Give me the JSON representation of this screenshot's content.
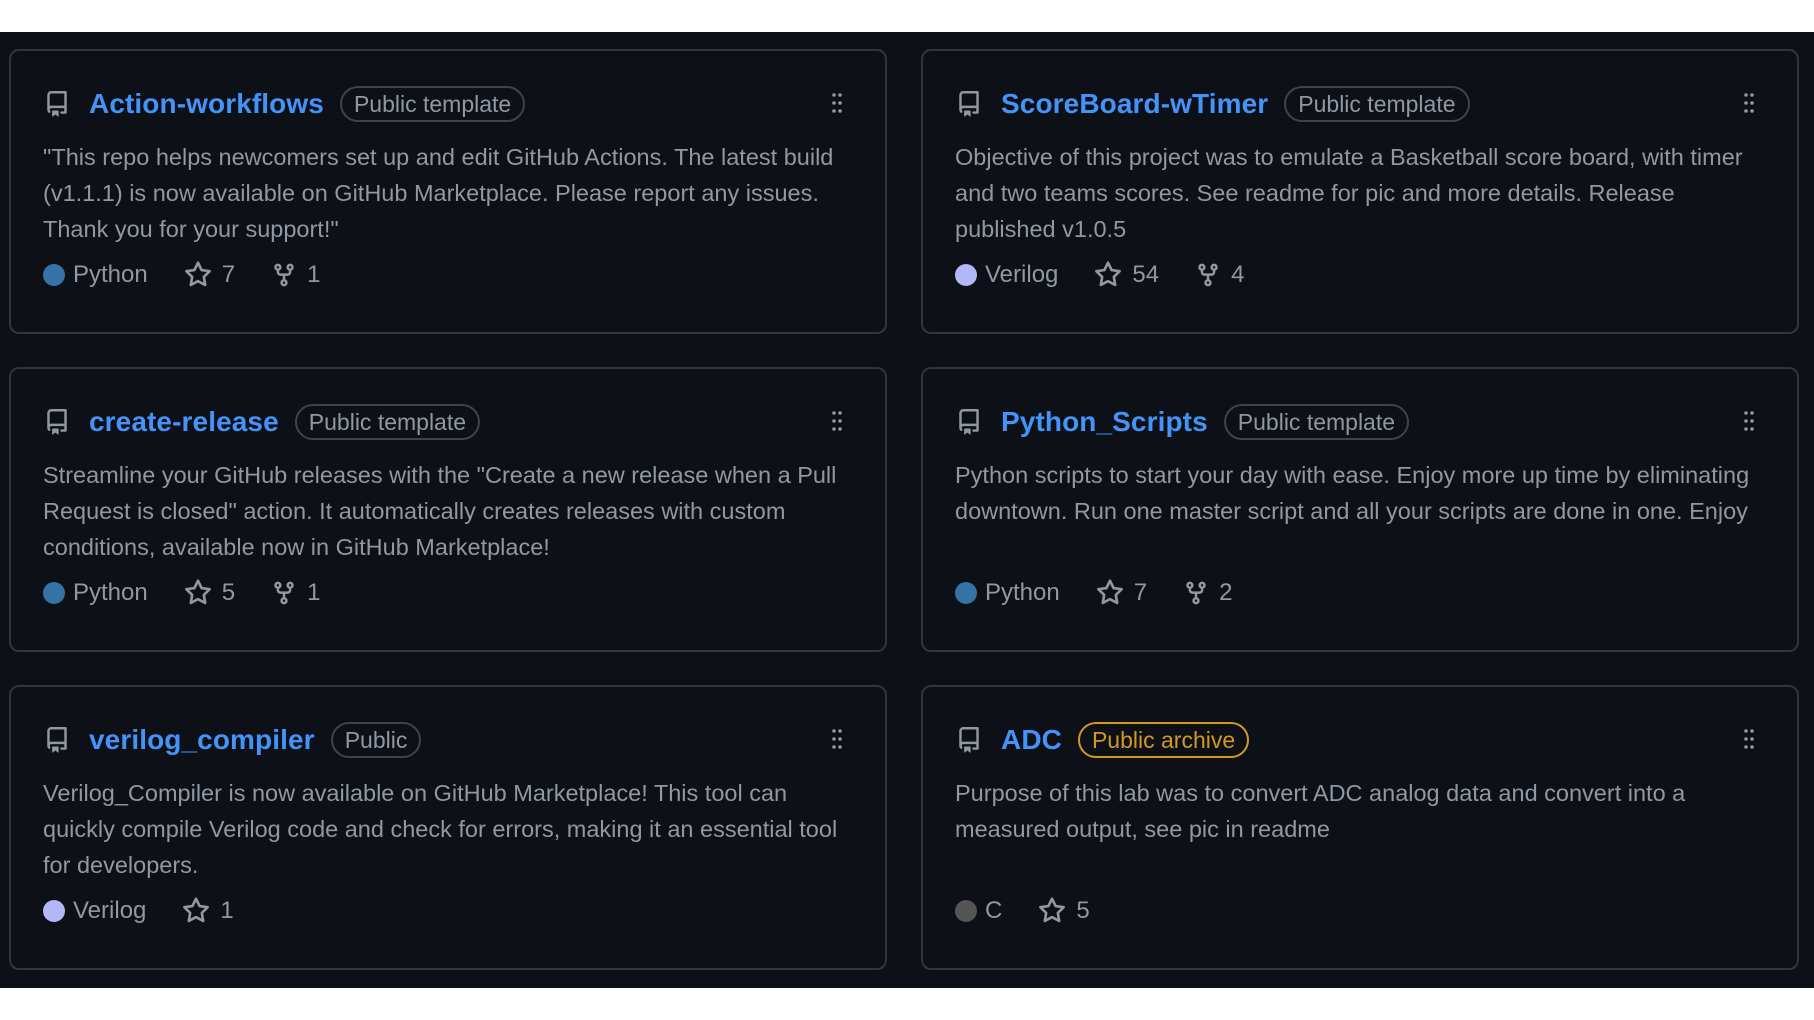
{
  "colors": {
    "page_background": "#ffffff",
    "board_background": "#0d1117",
    "card_border": "#30363d",
    "link": "#4493f8",
    "muted_text": "#9198a1",
    "archive_badge": "#d29922"
  },
  "pinned_repos": [
    {
      "name": "Action-workflows",
      "badge": "Public template",
      "badge_type": "default",
      "description": "\"This repo helps newcomers set up and edit GitHub Actions. The latest build (v1.1.1) is now available on GitHub Marketplace. Please report any issues. Thank you for your support!\"",
      "language": "Python",
      "language_color": "#3572A5",
      "stars": "7",
      "forks": "1"
    },
    {
      "name": "ScoreBoard-wTimer",
      "badge": "Public template",
      "badge_type": "default",
      "description": "Objective of this project was to emulate a Basketball score board, with timer and two teams scores. See readme for pic and more details. Release published v1.0.5",
      "language": "Verilog",
      "language_color": "#b2b7f8",
      "stars": "54",
      "forks": "4"
    },
    {
      "name": "create-release",
      "badge": "Public template",
      "badge_type": "default",
      "description": "Streamline your GitHub releases with the \"Create a new release when a Pull Request is closed\" action. It automatically creates releases with custom conditions, available now in GitHub Marketplace!",
      "language": "Python",
      "language_color": "#3572A5",
      "stars": "5",
      "forks": "1"
    },
    {
      "name": "Python_Scripts",
      "badge": "Public template",
      "badge_type": "default",
      "description": "Python scripts to start your day with ease. Enjoy more up time by eliminating downtown. Run one master script and all your scripts are done in one. Enjoy",
      "language": "Python",
      "language_color": "#3572A5",
      "stars": "7",
      "forks": "2"
    },
    {
      "name": "verilog_compiler",
      "badge": "Public",
      "badge_type": "default",
      "description": "Verilog_Compiler is now available on GitHub Marketplace! This tool can quickly compile Verilog code and check for errors, making it an essential tool for developers.",
      "language": "Verilog",
      "language_color": "#b2b7f8",
      "stars": "1",
      "forks": null
    },
    {
      "name": "ADC",
      "badge": "Public archive",
      "badge_type": "archive",
      "description": "Purpose of this lab was to convert ADC analog data and convert into a measured output, see pic in readme",
      "language": "C",
      "language_color": "#555555",
      "stars": "5",
      "forks": null
    }
  ]
}
